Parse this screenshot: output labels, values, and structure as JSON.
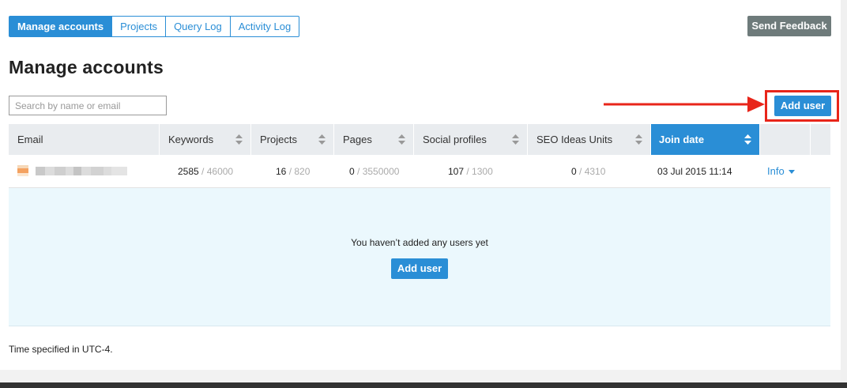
{
  "tabs": [
    {
      "label": "Manage accounts",
      "active": true
    },
    {
      "label": "Projects",
      "active": false
    },
    {
      "label": "Query Log",
      "active": false
    },
    {
      "label": "Activity Log",
      "active": false
    }
  ],
  "feedback_label": "Send Feedback",
  "page_title": "Manage accounts",
  "search": {
    "placeholder": "Search by name or email",
    "value": ""
  },
  "add_user_label": "Add user",
  "table": {
    "columns": [
      {
        "label": "Email"
      },
      {
        "label": "Keywords"
      },
      {
        "label": "Projects"
      },
      {
        "label": "Pages"
      },
      {
        "label": "Social profiles"
      },
      {
        "label": "SEO Ideas Units"
      },
      {
        "label": "Join date"
      }
    ],
    "row": {
      "keywords": {
        "used": "2585",
        "limit": "/ 46000"
      },
      "projects": {
        "used": "16",
        "limit": "/ 820"
      },
      "pages": {
        "used": "0",
        "limit": "/ 3550000"
      },
      "social": {
        "used": "107",
        "limit": "/ 1300"
      },
      "seo_ideas": {
        "used": "0",
        "limit": "/ 4310"
      },
      "join_date": "03 Jul 2015 11:14",
      "info_label": "Info"
    }
  },
  "empty_state": {
    "message": "You haven’t added any users yet",
    "button_label": "Add user"
  },
  "footnote": "Time specified in UTC-4.",
  "colors": {
    "accent": "#2a8ed6",
    "feedback": "#6e7b7b",
    "annotation": "#e8251a",
    "empty_bg": "#ebf8fd"
  },
  "icons": [
    "sort-icon",
    "chevron-down-icon",
    "arrow-annotation-icon"
  ]
}
